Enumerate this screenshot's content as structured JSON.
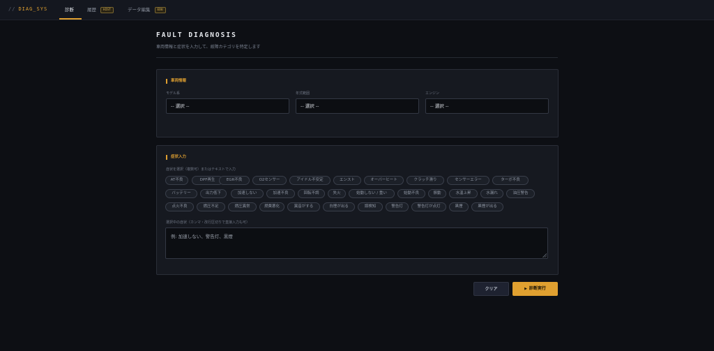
{
  "nav": {
    "logo_slash": "//",
    "logo_text": "DIAG_SYS",
    "tabs": [
      {
        "label": "診断",
        "badge": ""
      },
      {
        "label": "履歴",
        "badge": "HIST"
      },
      {
        "label": "データ編集",
        "badge": "EDU"
      }
    ]
  },
  "header": {
    "title": "FAULT DIAGNOSIS",
    "subtitle": "車両情報と症状を入力して、故障カテゴリを特定します"
  },
  "vehicle": {
    "section_label": "車両情報",
    "fields": [
      {
        "label": "モデル系",
        "value": "-- 選択 --"
      },
      {
        "label": "年式範囲",
        "value": "-- 選択 --"
      },
      {
        "label": "エンジン",
        "value": "-- 選択 --"
      }
    ]
  },
  "symptoms": {
    "section_label": "症状入力",
    "hint": "症状を選択（複数可）またはテキストで入力",
    "chips": [
      "AT不良",
      "DPF再生",
      "EGR不良",
      "O2センサー",
      "アイドル不安定",
      "エンスト",
      "オーバーヒート",
      "クラッチ滑り",
      "センサーエラー",
      "ターボ不良",
      "バッテリー",
      "出力低下",
      "加速しない",
      "加速不良",
      "回転不調",
      "失火",
      "始動しない / 重い",
      "始動不良",
      "振動",
      "水温上昇",
      "水漏れ",
      "油圧警告",
      "点火不良",
      "燃圧不足",
      "燃圧異常",
      "燃費悪化",
      "異音がする",
      "白煙が出る",
      "誤検知",
      "警告灯",
      "警告灯が点灯",
      "黒煙",
      "黒煙が出る"
    ],
    "selected_label": "選択中の症状（カンマ・改行区切りで直接入力も可）",
    "textarea_placeholder": "例: 加速しない、警告灯、黒煙",
    "textarea_value": ""
  },
  "actions": {
    "clear_label": "クリア",
    "run_icon": "▶",
    "run_label": "診断実行"
  },
  "colors": {
    "accent": "#e0a030",
    "background": "#0d0f14",
    "panel": "#161920"
  }
}
